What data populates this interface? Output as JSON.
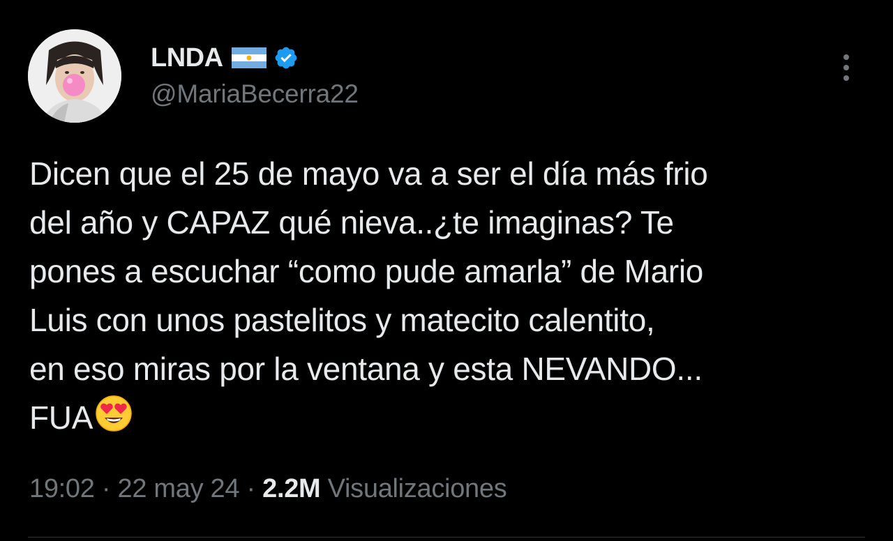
{
  "author": {
    "display_name": "LNDA",
    "handle": "@MariaBecerra22",
    "flag_icon": "argentina-flag-icon",
    "verified_icon": "verified-badge-icon",
    "verified_color": "#1d9bf0"
  },
  "tweet": {
    "lines": [
      "Dicen que el 25 de mayo va a ser el día más frio",
      "del año y CAPAZ qué nieva..¿te imaginas? Te",
      "pones a escuchar “como pude amarla” de Mario",
      "Luis con unos pastelitos y matecito calentito,",
      "en eso miras por la ventana y esta NEVANDO...",
      "FUA"
    ],
    "trailing_emoji": "😍"
  },
  "meta": {
    "time": "19:02",
    "separator": "·",
    "date": "22 may 24",
    "views_count": "2.2M",
    "views_label": "Visualizaciones"
  },
  "colors": {
    "background": "#000000",
    "text": "#e7e9ea",
    "muted": "#71767b"
  }
}
